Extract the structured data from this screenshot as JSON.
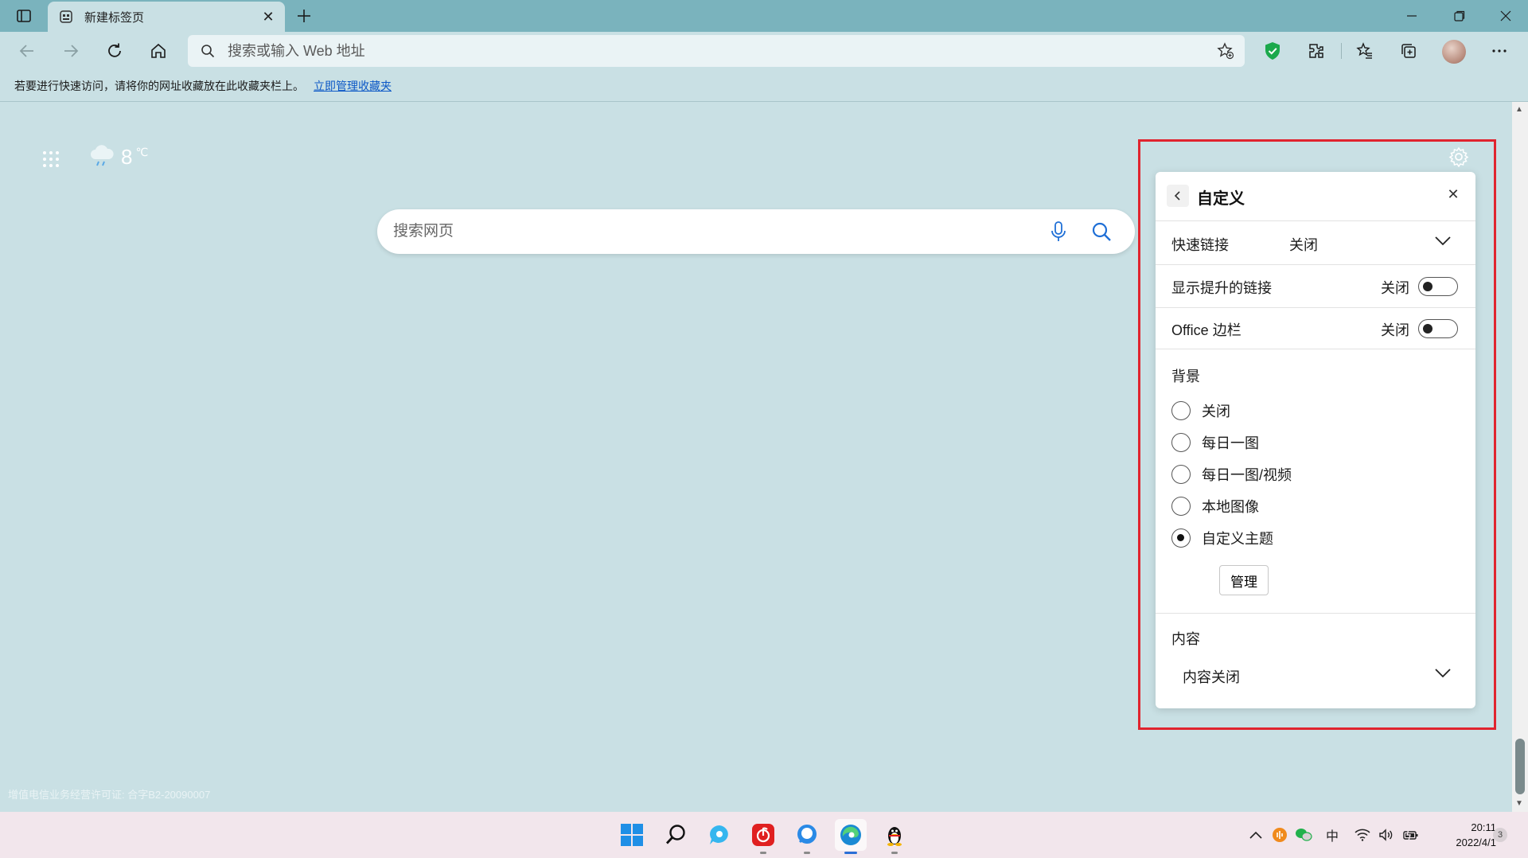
{
  "browser": {
    "tab": {
      "title": "新建标签页"
    },
    "address": {
      "placeholder": "搜索或输入 Web 地址"
    },
    "favorites_bar": {
      "message": "若要进行快速访问，请将你的网址收藏放在此收藏夹栏上。",
      "link": "立即管理收藏夹"
    }
  },
  "page": {
    "weather": {
      "temp": "8",
      "unit": "℃"
    },
    "search": {
      "placeholder": "搜索网页"
    },
    "license": "增值电信业务经营许可证: 合字B2-20090007"
  },
  "panel": {
    "title": "自定义",
    "quick_links": {
      "label": "快速链接",
      "value": "关闭"
    },
    "promoted_links": {
      "label": "显示提升的链接",
      "value": "关闭"
    },
    "office_sidebar": {
      "label": "Office 边栏",
      "value": "关闭"
    },
    "background": {
      "label": "背景",
      "options": [
        "关闭",
        "每日一图",
        "每日一图/视频",
        "本地图像",
        "自定义主题"
      ],
      "selected": "自定义主题",
      "manage_label": "管理"
    },
    "content": {
      "label": "内容",
      "value": "内容关闭"
    }
  },
  "taskbar": {
    "tray_ime": "中",
    "time": "20:11",
    "date": "2022/4/1",
    "notifications": "3"
  },
  "colors": {
    "highlight": "#e0242e",
    "page_bg": "#c9e0e4",
    "tab_bar": "#7ab3bd"
  }
}
